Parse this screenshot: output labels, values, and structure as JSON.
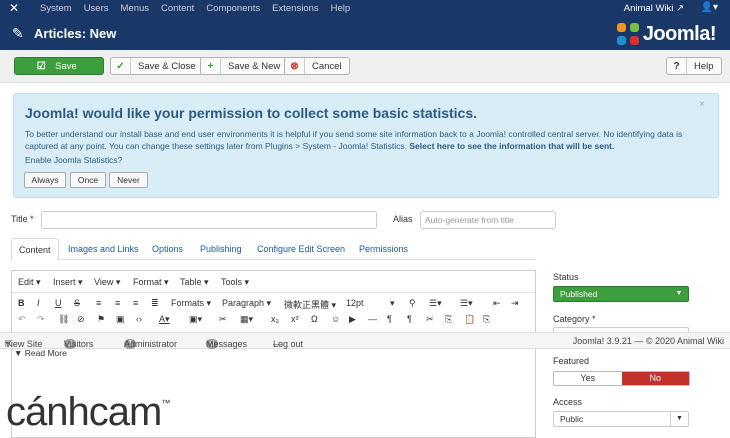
{
  "topnav": {
    "menu": [
      "System",
      "Users",
      "Menus",
      "Content",
      "Components",
      "Extensions",
      "Help"
    ],
    "site_name": "Animal Wiki",
    "site_icon": "external-link-icon",
    "user_icon": "user-icon"
  },
  "header": {
    "title": "Articles: New",
    "logo_text": "Joomla!"
  },
  "toolbar": {
    "save": "Save",
    "save_close": "Save & Close",
    "save_new": "Save & New",
    "cancel": "Cancel",
    "help": "Help"
  },
  "stats_message": {
    "heading": "Joomla! would like your permission to collect some basic statistics.",
    "body": "To better understand our install base and end user environments it is helpful if you send some site information back to a Joomla! controlled central server. No identifying data is captured at any point. You can change these settings later from Plugins > System - Joomla! Statistics.",
    "link": "Select here to see the information that will be sent.",
    "question": "Enable Joomla Statistics?",
    "buttons": [
      "Always",
      "Once",
      "Never"
    ],
    "close": "×"
  },
  "form": {
    "title_label": "Title *",
    "title_value": "",
    "alias_label": "Alias",
    "alias_placeholder": "Auto-generate from title"
  },
  "tabs": [
    "Content",
    "Images and Links",
    "Options",
    "Publishing",
    "Configure Edit Screen",
    "Permissions"
  ],
  "editor": {
    "menus": [
      "Edit ▾",
      "Insert ▾",
      "View ▾",
      "Format ▾",
      "Table ▾",
      "Tools ▾"
    ],
    "formats": "Formats ▾",
    "paragraph": "Paragraph ▾",
    "font": "微軟正黑體 ▾",
    "size": "12pt",
    "read_more": "Read More"
  },
  "statusbar": {
    "view_site": "View Site",
    "visitors_count": "0",
    "visitors": "Visitors",
    "admins_count": "1",
    "admins": "Administrator",
    "messages_count": "0",
    "messages": "Messages",
    "logout": "Log out",
    "version": "Joomla! 3.9.21 — © 2020 Animal Wiki"
  },
  "sidebar": {
    "status_label": "Status",
    "status_value": "Published",
    "category_label": "Category *",
    "featured_label": "Featured",
    "featured_yes": "Yes",
    "featured_no": "No",
    "access_label": "Access",
    "access_value": "Public"
  },
  "watermark": "cánhcam",
  "watermark_tm": "™",
  "colors": {
    "nav_bg": "#1a3867",
    "save_green": "#3d9e3d",
    "alert_bg": "#d9edf7",
    "no_red": "#c4312b",
    "link_blue": "#1e5aa8"
  }
}
